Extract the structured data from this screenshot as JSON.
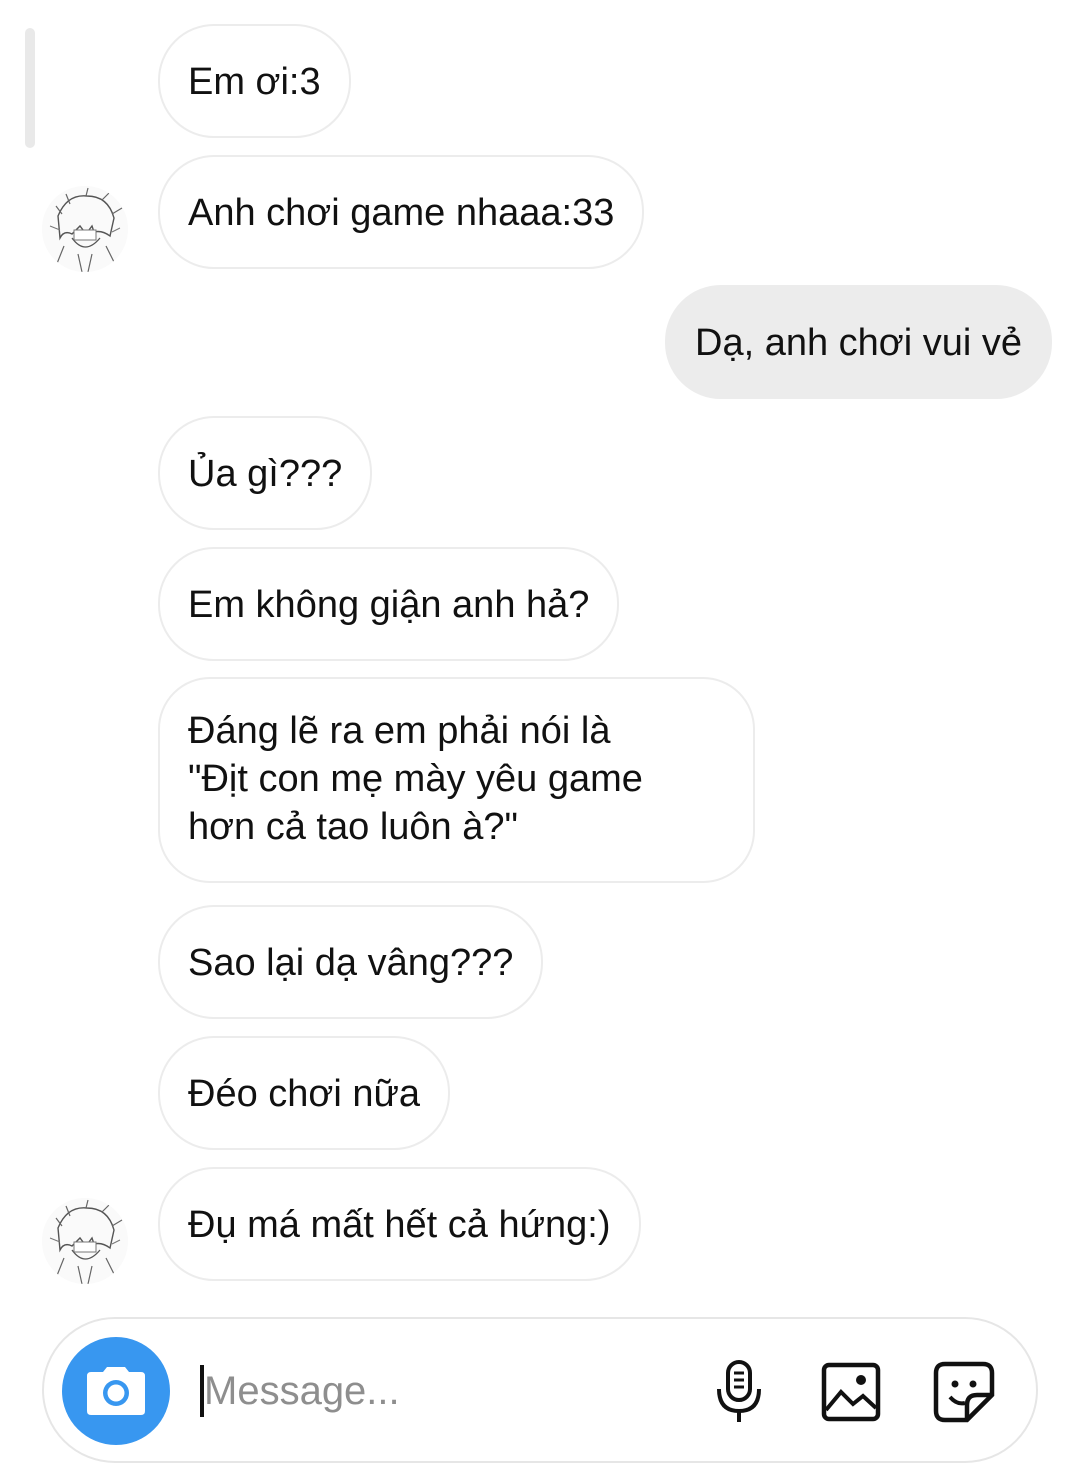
{
  "messages": [
    {
      "text": "Em ơi:3",
      "sender": "them"
    },
    {
      "text": "Anh chơi game nhaaa:33",
      "sender": "them"
    },
    {
      "text": "Dạ, anh chơi vui vẻ",
      "sender": "me"
    },
    {
      "text": "Ủa gì???",
      "sender": "them"
    },
    {
      "text": "Em không giận anh hả?",
      "sender": "them"
    },
    {
      "lines": [
        "Đáng lẽ ra em phải nói là",
        "\"Địt con mẹ mày yêu game",
        "hơn cả tao luôn à?\""
      ],
      "sender": "them"
    },
    {
      "text": "Sao lại dạ vâng???",
      "sender": "them"
    },
    {
      "text": "Đéo chơi nữa",
      "sender": "them"
    },
    {
      "text": "Đụ má mất hết cả hứng:)",
      "sender": "them"
    }
  ],
  "composer": {
    "placeholder": "Message...",
    "value": "",
    "camera_icon": "camera-icon",
    "mic_icon": "microphone-icon",
    "gallery_icon": "image-gallery-icon",
    "sticker_icon": "sticker-icon"
  },
  "colors": {
    "accent": "#3897f0",
    "outgoing_bubble": "#ececec",
    "incoming_border": "#ececec",
    "placeholder": "#8e8e8e"
  }
}
